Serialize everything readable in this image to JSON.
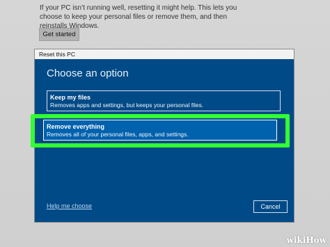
{
  "background": {
    "description": "If your PC isn’t running well, resetting it might help. This lets you choose to keep your personal files or remove them, and then reinstalls Windows.",
    "get_started_label": "Get started"
  },
  "dialog": {
    "title": "Reset this PC",
    "heading": "Choose an option",
    "options": [
      {
        "title": "Keep my files",
        "subtitle": "Removes apps and settings, but keeps your personal files."
      },
      {
        "title": "Remove everything",
        "subtitle": "Removes all of your personal files, apps, and settings."
      }
    ],
    "help_link": "Help me choose",
    "cancel_label": "Cancel"
  },
  "watermark": "wikiHow",
  "colors": {
    "dialog_bg": "#004a87",
    "highlight": "#33ff33",
    "selected_option_bg": "#0061ad"
  }
}
